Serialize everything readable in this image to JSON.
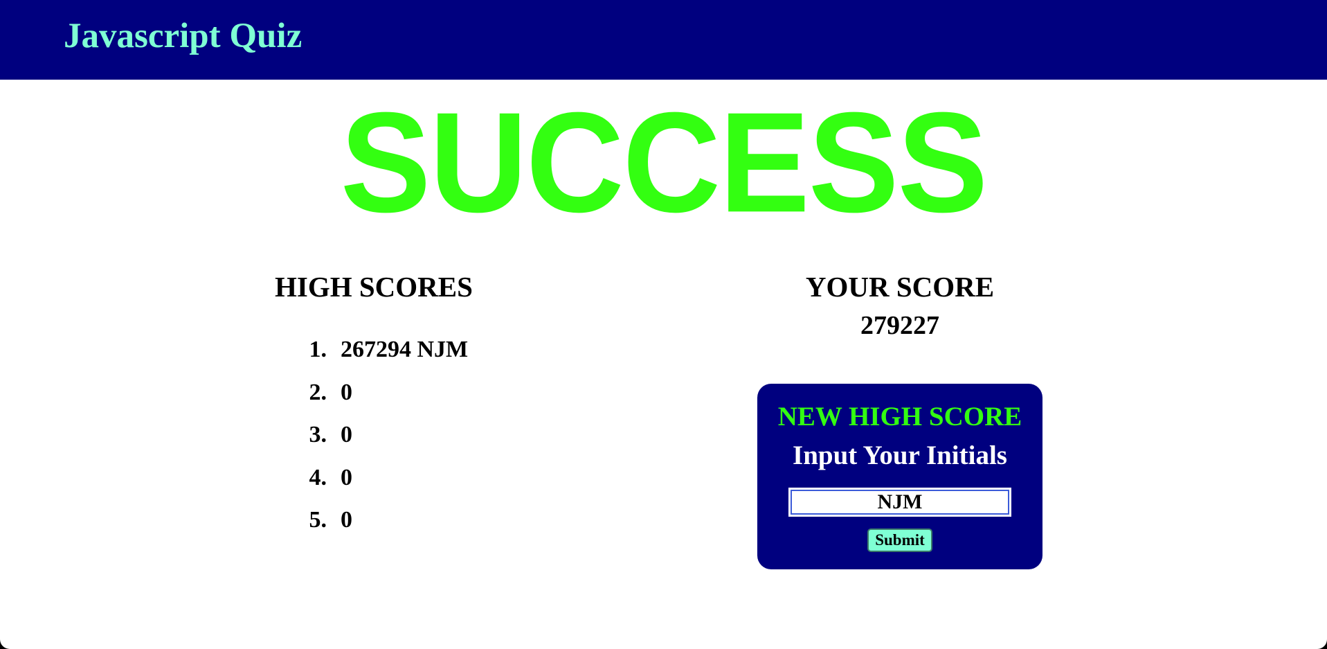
{
  "header": {
    "title": "Javascript Quiz"
  },
  "main": {
    "result_text": "SUCCESS"
  },
  "high_scores": {
    "title": "HIGH SCORES",
    "items": [
      {
        "rank": "1.",
        "entry": "267294 NJM"
      },
      {
        "rank": "2.",
        "entry": "0"
      },
      {
        "rank": "3.",
        "entry": "0"
      },
      {
        "rank": "4.",
        "entry": "0"
      },
      {
        "rank": "5.",
        "entry": "0"
      }
    ]
  },
  "your_score": {
    "title": "YOUR SCORE",
    "value": "279227"
  },
  "new_high_score": {
    "heading": "NEW HIGH SCORE",
    "prompt": "Input Your Initials",
    "initials_value": "NJM",
    "submit_label": "Submit"
  },
  "colors": {
    "header_bg": "#00007f",
    "title_text": "#7fffd4",
    "success_green": "#33ff11",
    "button_bg": "#7fffd4"
  }
}
